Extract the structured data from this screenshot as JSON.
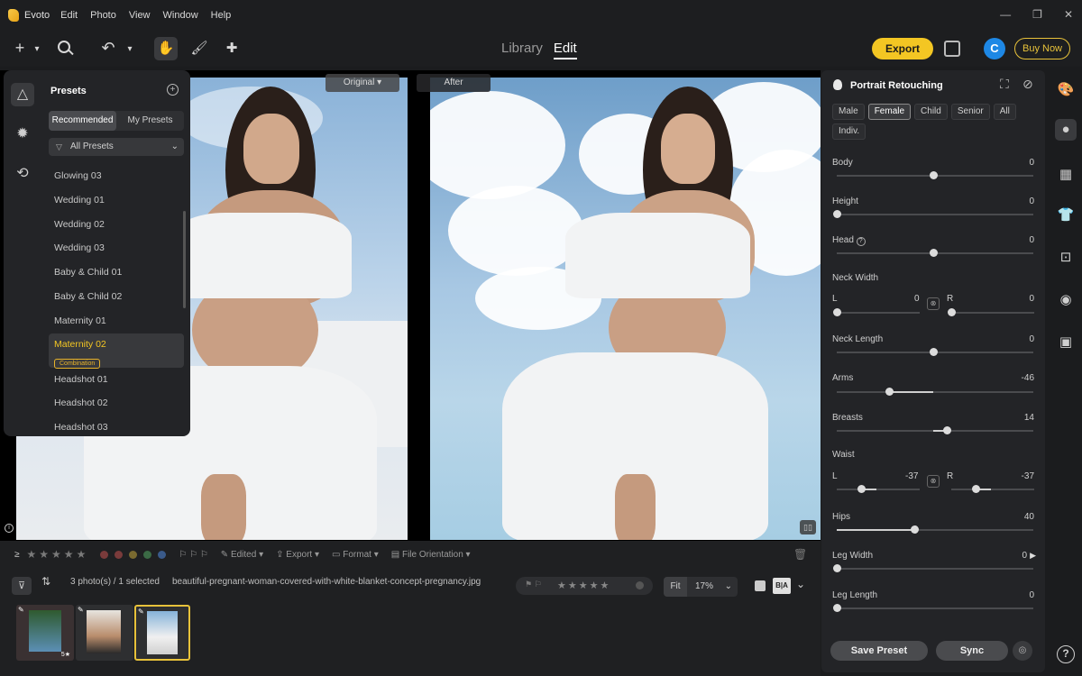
{
  "app": {
    "name": "Evoto",
    "menu": [
      "Edit",
      "Photo",
      "View",
      "Window",
      "Help"
    ],
    "window_controls": [
      "—",
      "❐",
      "✕"
    ]
  },
  "toolbar": {
    "tabs": [
      "Library",
      "Edit"
    ],
    "active_tab": "Edit",
    "export_label": "Export",
    "avatar_letter": "C",
    "buy_label": "Buy Now",
    "accent_color": "#f3c623"
  },
  "presets": {
    "title": "Presets",
    "segments": [
      "Recommended",
      "My Presets"
    ],
    "active_segment": "Recommended",
    "filter_label": "All Presets",
    "items": [
      {
        "label": "Glowing 03"
      },
      {
        "label": "Wedding 01"
      },
      {
        "label": "Wedding 02"
      },
      {
        "label": "Wedding 03"
      },
      {
        "label": "Baby & Child 01"
      },
      {
        "label": "Baby & Child 02"
      },
      {
        "label": "Maternity 01"
      },
      {
        "label": "Maternity 02",
        "badge": "Combination",
        "selected": true
      },
      {
        "label": "Headshot 01"
      },
      {
        "label": "Headshot 02"
      },
      {
        "label": "Headshot 03"
      }
    ]
  },
  "canvas": {
    "before_label": "Original",
    "after_label": "After"
  },
  "retouch": {
    "title": "Portrait Retouching",
    "chips": [
      "Male",
      "Female",
      "Child",
      "Senior",
      "All",
      "Indiv."
    ],
    "active_chip": "Female",
    "sliders": {
      "body": {
        "label": "Body",
        "value": "0"
      },
      "height": {
        "label": "Height",
        "value": "0"
      },
      "head": {
        "label": "Head",
        "value": "0"
      },
      "neck_width": {
        "label": "Neck Width",
        "l_label": "L",
        "l_value": "0",
        "r_label": "R",
        "r_value": "0"
      },
      "neck_length": {
        "label": "Neck Length",
        "value": "0"
      },
      "arms": {
        "label": "Arms",
        "value": "-46"
      },
      "breasts": {
        "label": "Breasts",
        "value": "14"
      },
      "waist": {
        "label": "Waist",
        "l_label": "L",
        "l_value": "-37",
        "r_label": "R",
        "r_value": "-37"
      },
      "hips": {
        "label": "Hips",
        "value": "40"
      },
      "leg_width": {
        "label": "Leg Width",
        "value": "0"
      },
      "leg_length": {
        "label": "Leg Length",
        "value": "0"
      }
    },
    "save_preset_label": "Save Preset",
    "sync_label": "Sync"
  },
  "bottom": {
    "edited_label": "Edited",
    "export_label": "Export",
    "format_label": "Format",
    "orientation_label": "File Orientation",
    "color_labels": [
      "#c0392b",
      "#c0392b",
      "#d4a017",
      "#27ae60",
      "#2d7dd2"
    ],
    "photo_count": "3 photo(s) / 1 selected",
    "filename": "beautiful-pregnant-woman-covered-with-white-blanket-concept-pregnancy.jpg",
    "fit_label": "Fit",
    "zoom": "17%",
    "thumb1_rating": "5★"
  }
}
